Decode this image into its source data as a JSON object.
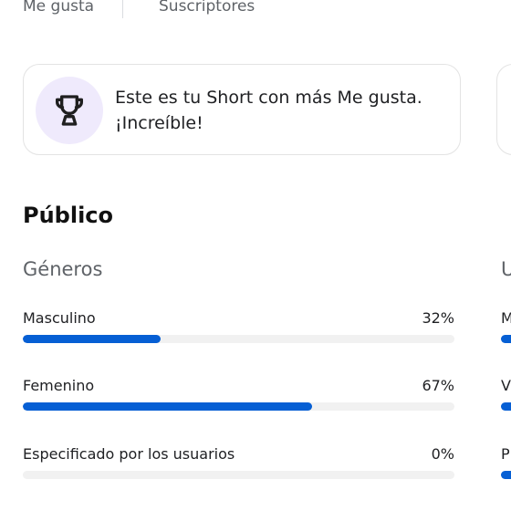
{
  "stats_header": {
    "left_label": "Me gusta",
    "right_label": "Suscriptores"
  },
  "highlight_card": {
    "icon": "trophy-icon",
    "line1": "Este es tu Short con más Me gusta.",
    "line2": "¡Increíble!"
  },
  "audience": {
    "title": "Público",
    "genders": {
      "title": "Géneros",
      "rows": [
        {
          "label": "Masculino",
          "value": "32%",
          "fraction": 0.32
        },
        {
          "label": "Femenino",
          "value": "67%",
          "fraction": 0.67
        },
        {
          "label": "Especificado por los usuarios",
          "value": "0%",
          "fraction": 0.0
        }
      ]
    },
    "next_panel_peek": {
      "title": "U",
      "row_letters": [
        "M",
        "V",
        "P"
      ]
    }
  },
  "colors": {
    "accent": "#065fd4",
    "track": "#f1f1f1",
    "trophy_bg": "#efeafc"
  }
}
